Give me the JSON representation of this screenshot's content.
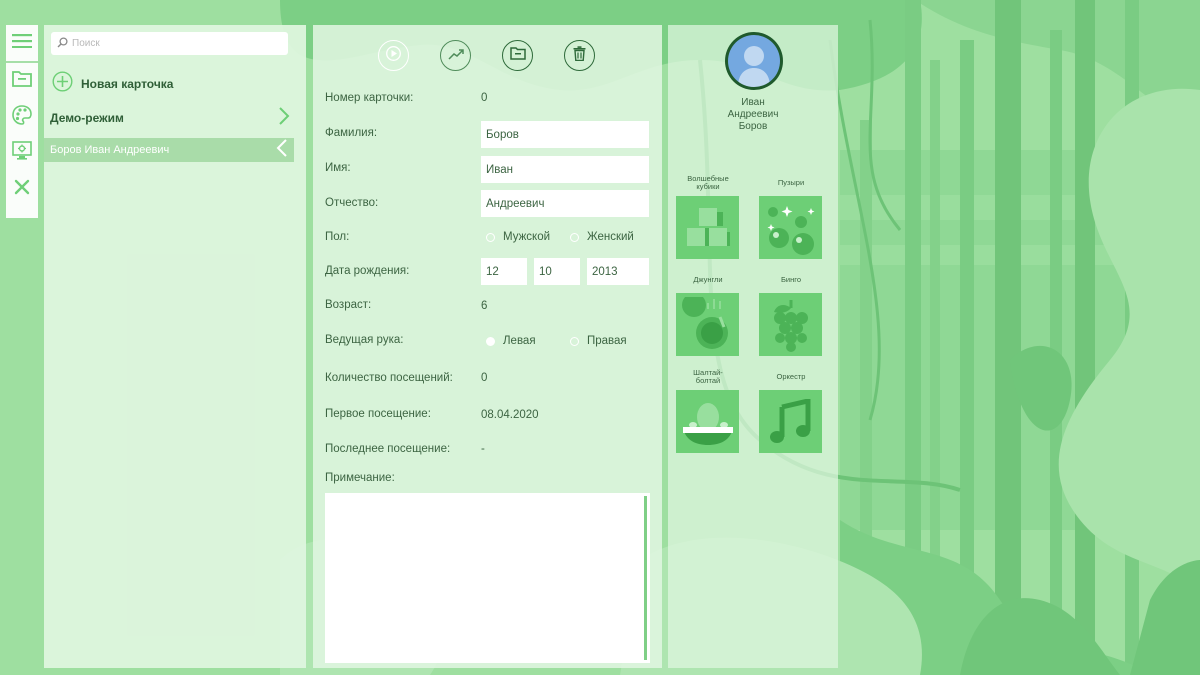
{
  "colors": {
    "accent": "#2e6a3a",
    "panel": "#e0f6e0",
    "selected_row": "#a9dca9",
    "game_tile": "#6dcf76"
  },
  "toolbar": {
    "icons": [
      "menu-icon",
      "folder-icon",
      "palette-icon",
      "monitor-settings-icon",
      "close-icon"
    ]
  },
  "sidebar": {
    "search_placeholder": "Поиск",
    "new_card_label": "Новая карточка",
    "demo_label": "Демо-режим",
    "selected_patient": "Боров Иван Андреевич"
  },
  "form": {
    "action_icons": [
      "play-icon",
      "chart-icon",
      "folder-icon",
      "trash-icon"
    ],
    "card_number": {
      "label": "Номер карточки:",
      "value": "0"
    },
    "surname": {
      "label": "Фамилия:",
      "value": "Боров"
    },
    "first_name": {
      "label": "Имя:",
      "value": "Иван"
    },
    "patronymic": {
      "label": "Отчество:",
      "value": "Андреевич"
    },
    "sex": {
      "label": "Пол:",
      "male": "Мужской",
      "female": "Женский",
      "selected": "none"
    },
    "birth_date": {
      "label": "Дата рождения:",
      "day": "12",
      "month": "10",
      "year": "2013"
    },
    "age": {
      "label": "Возраст:",
      "value": "6"
    },
    "hand": {
      "label": "Ведущая рука:",
      "left": "Левая",
      "right": "Правая",
      "selected": "left"
    },
    "visits": {
      "label": "Количество посещений:",
      "value": "0"
    },
    "first_visit": {
      "label": "Первое посещение:",
      "value": "08.04.2020"
    },
    "last_visit": {
      "label": "Последнее посещение:",
      "value": "-"
    },
    "note": {
      "label": "Примечание:",
      "value": ""
    }
  },
  "profile": {
    "name_lines": [
      "Иван",
      "Андреевич",
      "Боров"
    ]
  },
  "games": [
    {
      "title_lines": [
        "Волшебные",
        "кубики"
      ],
      "icon": "cubes-icon"
    },
    {
      "title_lines": [
        "Пузыри"
      ],
      "icon": "bubbles-icon"
    },
    {
      "title_lines": [
        "Джунгли"
      ],
      "icon": "coconut-icon"
    },
    {
      "title_lines": [
        "Бинго"
      ],
      "icon": "grapes-icon"
    },
    {
      "title_lines": [
        "Шалтай-",
        "болтай"
      ],
      "icon": "egg-nest-icon"
    },
    {
      "title_lines": [
        "Оркестр"
      ],
      "icon": "music-note-icon"
    }
  ]
}
